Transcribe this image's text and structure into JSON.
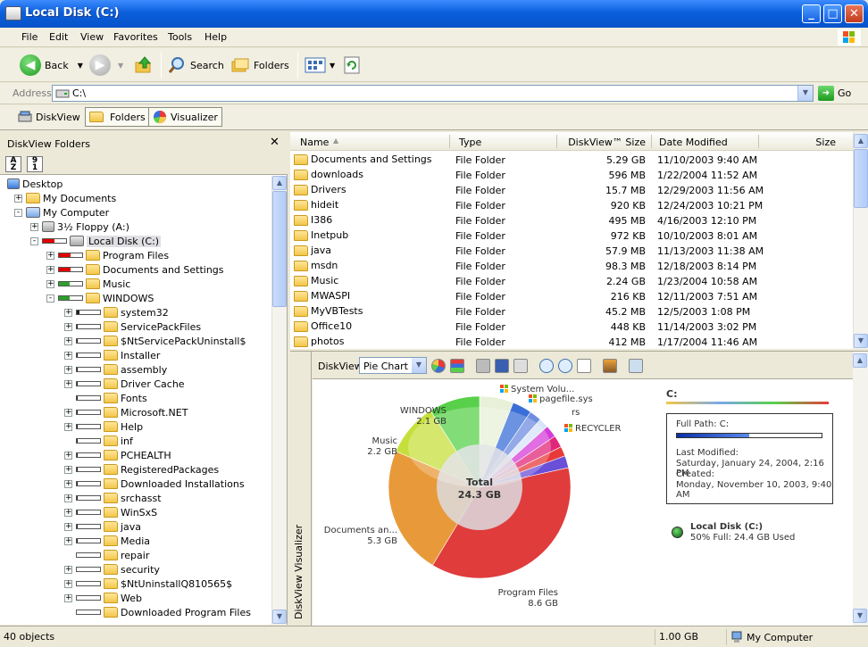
{
  "window": {
    "title": "Local Disk (C:)"
  },
  "menu": [
    "File",
    "Edit",
    "View",
    "Favorites",
    "Tools",
    "Help"
  ],
  "toolbar": {
    "back": "Back",
    "search": "Search",
    "folders": "Folders"
  },
  "address": {
    "label": "Address",
    "value": "C:\\",
    "go": "Go"
  },
  "diskview_bar": {
    "diskview": "DiskView",
    "folders": "Folders",
    "visualizer": "Visualizer"
  },
  "folders_pane": {
    "title": "DiskView Folders",
    "tree": [
      {
        "label": "Desktop",
        "level": 0,
        "toggle": "",
        "icon": "desktop"
      },
      {
        "label": "My Documents",
        "level": 1,
        "toggle": "+",
        "icon": "folder"
      },
      {
        "label": "My Computer",
        "level": 1,
        "toggle": "-",
        "icon": "computer"
      },
      {
        "label": "3½ Floppy (A:)",
        "level": 2,
        "toggle": "+",
        "icon": "floppy"
      },
      {
        "label": "Local Disk (C:)",
        "level": 2,
        "toggle": "-",
        "icon": "drive",
        "bar": "#e00000",
        "barfill": 0.5,
        "selected": true
      },
      {
        "label": "Program Files",
        "level": 3,
        "toggle": "+",
        "icon": "folder",
        "bar": "#e00000",
        "barfill": 0.5
      },
      {
        "label": "Documents and Settings",
        "level": 3,
        "toggle": "+",
        "icon": "folder",
        "bar": "#e00000",
        "barfill": 0.5
      },
      {
        "label": "Music",
        "level": 3,
        "toggle": "+",
        "icon": "folder",
        "bar": "#2ca02c",
        "barfill": 0.45
      },
      {
        "label": "WINDOWS",
        "level": 3,
        "toggle": "-",
        "icon": "folder",
        "bar": "#2ca02c",
        "barfill": 0.45
      },
      {
        "label": "system32",
        "level": 4,
        "toggle": "+",
        "icon": "folder",
        "bar": "#222",
        "barfill": 0.1
      },
      {
        "label": "ServicePackFiles",
        "level": 4,
        "toggle": "+",
        "icon": "folder",
        "bar": "#222",
        "barfill": 0.05
      },
      {
        "label": "$NtServicePackUninstall$",
        "level": 4,
        "toggle": "+",
        "icon": "folder",
        "bar": "#222",
        "barfill": 0.05
      },
      {
        "label": "Installer",
        "level": 4,
        "toggle": "+",
        "icon": "folder",
        "bar": "#222",
        "barfill": 0.05
      },
      {
        "label": "assembly",
        "level": 4,
        "toggle": "+",
        "icon": "folder",
        "bar": "#222",
        "barfill": 0.04
      },
      {
        "label": "Driver Cache",
        "level": 4,
        "toggle": "+",
        "icon": "folder",
        "bar": "#222",
        "barfill": 0.04
      },
      {
        "label": "Fonts",
        "level": 4,
        "toggle": "",
        "icon": "folder",
        "bar": "#222",
        "barfill": 0.03
      },
      {
        "label": "Microsoft.NET",
        "level": 4,
        "toggle": "+",
        "icon": "folder",
        "bar": "#222",
        "barfill": 0.03
      },
      {
        "label": "Help",
        "level": 4,
        "toggle": "+",
        "icon": "folder",
        "bar": "#222",
        "barfill": 0.03
      },
      {
        "label": "inf",
        "level": 4,
        "toggle": "",
        "icon": "folder",
        "bar": "#222",
        "barfill": 0.02
      },
      {
        "label": "PCHEALTH",
        "level": 4,
        "toggle": "+",
        "icon": "folder",
        "bar": "#222",
        "barfill": 0.02
      },
      {
        "label": "RegisteredPackages",
        "level": 4,
        "toggle": "+",
        "icon": "folder",
        "bar": "#222",
        "barfill": 0.02
      },
      {
        "label": "Downloaded Installations",
        "level": 4,
        "toggle": "+",
        "icon": "folder",
        "bar": "#222",
        "barfill": 0.02
      },
      {
        "label": "srchasst",
        "level": 4,
        "toggle": "+",
        "icon": "folder",
        "bar": "#222",
        "barfill": 0.02
      },
      {
        "label": "WinSxS",
        "level": 4,
        "toggle": "+",
        "icon": "folder",
        "bar": "#222",
        "barfill": 0.02
      },
      {
        "label": "java",
        "level": 4,
        "toggle": "+",
        "icon": "folder",
        "bar": "#222",
        "barfill": 0.02
      },
      {
        "label": "Media",
        "level": 4,
        "toggle": "+",
        "icon": "folder",
        "bar": "#222",
        "barfill": 0.02
      },
      {
        "label": "repair",
        "level": 4,
        "toggle": "",
        "icon": "folder",
        "bar": "#222",
        "barfill": 0.01
      },
      {
        "label": "security",
        "level": 4,
        "toggle": "+",
        "icon": "folder",
        "bar": "#222",
        "barfill": 0.01
      },
      {
        "label": "$NtUninstallQ810565$",
        "level": 4,
        "toggle": "+",
        "icon": "folder",
        "bar": "#222",
        "barfill": 0.01
      },
      {
        "label": "Web",
        "level": 4,
        "toggle": "+",
        "icon": "folder",
        "bar": "#222",
        "barfill": 0.01
      },
      {
        "label": "Downloaded Program Files",
        "level": 4,
        "toggle": "",
        "icon": "ie-folder",
        "bar": "#222",
        "barfill": 0.01
      }
    ]
  },
  "list": {
    "columns": [
      "Name",
      "Type",
      "DiskView™ Size",
      "Date Modified",
      "Size"
    ],
    "rows": [
      {
        "name": "Documents and Settings",
        "type": "File Folder",
        "size": "5.29 GB",
        "date": "11/10/2003 9:40 AM"
      },
      {
        "name": "downloads",
        "type": "File Folder",
        "size": "596 MB",
        "date": "1/22/2004 11:52 AM"
      },
      {
        "name": "Drivers",
        "type": "File Folder",
        "size": "15.7 MB",
        "date": "12/29/2003 11:56 AM"
      },
      {
        "name": "hideit",
        "type": "File Folder",
        "size": "920 KB",
        "date": "12/24/2003 10:21 PM"
      },
      {
        "name": "I386",
        "type": "File Folder",
        "size": "495 MB",
        "date": "4/16/2003 12:10 PM"
      },
      {
        "name": "Inetpub",
        "type": "File Folder",
        "size": "972 KB",
        "date": "10/10/2003 8:01 AM"
      },
      {
        "name": "java",
        "type": "File Folder",
        "size": "57.9 MB",
        "date": "11/13/2003 11:38 AM"
      },
      {
        "name": "msdn",
        "type": "File Folder",
        "size": "98.3 MB",
        "date": "12/18/2003 8:14 PM"
      },
      {
        "name": "Music",
        "type": "File Folder",
        "size": "2.24 GB",
        "date": "1/23/2004 10:58 AM"
      },
      {
        "name": "MWASPI",
        "type": "File Folder",
        "size": "216 KB",
        "date": "12/11/2003 7:51 AM"
      },
      {
        "name": "MyVBTests",
        "type": "File Folder",
        "size": "45.2 MB",
        "date": "12/5/2003 1:08 PM"
      },
      {
        "name": "Office10",
        "type": "File Folder",
        "size": "448 KB",
        "date": "11/14/2003 3:02 PM"
      },
      {
        "name": "photos",
        "type": "File Folder",
        "size": "412 MB",
        "date": "1/17/2004 11:46 AM"
      }
    ]
  },
  "visualizer": {
    "side_label": "DiskView Visualizer",
    "label": "DiskView",
    "chart_select": "Pie Chart",
    "drive_label": "C:",
    "details": {
      "full_path": "Full Path: C:",
      "last_modified_label": "Last Modified:",
      "last_modified": "Saturday, January 24, 2004, 2:16 PM",
      "created_label": "Created:",
      "created": "Monday, November 10, 2003, 9:40 AM"
    },
    "disk": {
      "name": "Local Disk (C:)",
      "usage": "50% Full: 24.4 GB Used"
    },
    "total_label": "Total",
    "total_value": "24.3 GB"
  },
  "chart_data": {
    "type": "pie",
    "total": "24.3 GB",
    "slices": [
      {
        "name": "Program Files",
        "value": 8.6,
        "label": "8.6 GB",
        "color": "#e03c3c"
      },
      {
        "name": "Documents an...",
        "value": 5.3,
        "label": "5.3 GB",
        "color": "#e89a3a"
      },
      {
        "name": "Music",
        "value": 2.2,
        "label": "2.2 GB",
        "color": "#c7df3c"
      },
      {
        "name": "WINDOWS",
        "value": 2.1,
        "label": "2.1 GB",
        "color": "#58d04a"
      },
      {
        "name": "System Volu...",
        "value": 1.4,
        "label": "",
        "color": "#e8f0d8"
      },
      {
        "name": "pagefile.sys",
        "value": 0.8,
        "label": "",
        "color": "#3a6fd8"
      },
      {
        "name": "rs",
        "value": 0.5,
        "label": "",
        "color": "#6f8de0"
      },
      {
        "name": "RECYCLER",
        "value": 0.4,
        "label": "",
        "color": "#d7e3f8"
      },
      {
        "name": "",
        "value": 0.5,
        "label": "",
        "color": "#d63cd8"
      },
      {
        "name": "",
        "value": 0.5,
        "label": "",
        "color": "#e0287a"
      },
      {
        "name": "",
        "value": 0.4,
        "label": "",
        "color": "#e83a3a"
      },
      {
        "name": "",
        "value": 0.5,
        "label": "",
        "color": "#6a4fd8"
      }
    ]
  },
  "status": {
    "objects": "40 objects",
    "size": "1.00 GB",
    "location": "My Computer"
  },
  "colors": {
    "titlebar": "#0a5fdc",
    "selection": "#e0dfe3"
  }
}
